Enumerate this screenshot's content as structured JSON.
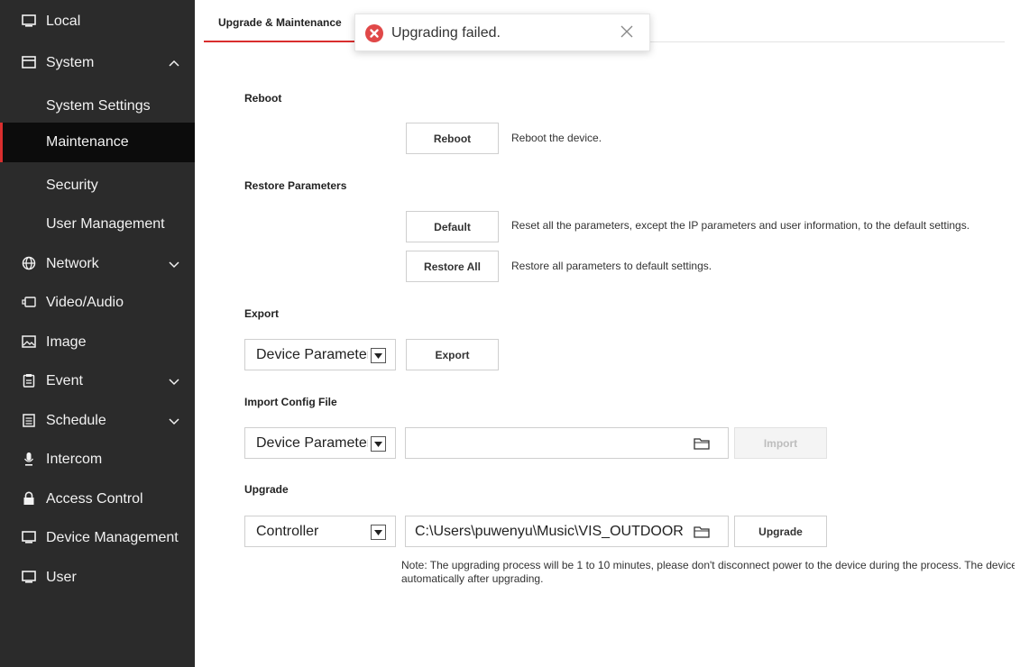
{
  "sidebar": {
    "local": "Local",
    "system": "System",
    "system_settings": "System Settings",
    "maintenance": "Maintenance",
    "security": "Security",
    "user_management": "User Management",
    "network": "Network",
    "video_audio": "Video/Audio",
    "image": "Image",
    "event": "Event",
    "schedule": "Schedule",
    "intercom": "Intercom",
    "access_control": "Access Control",
    "device_management": "Device Management",
    "user": "User"
  },
  "main": {
    "tab": "Upgrade & Maintenance",
    "reboot": {
      "title": "Reboot",
      "button": "Reboot",
      "description": "Reboot the device."
    },
    "restore": {
      "title": "Restore Parameters",
      "default_button": "Default",
      "default_description": "Reset all the parameters, except the IP parameters and user information, to the default settings.",
      "restore_all_button": "Restore All",
      "restore_all_description": "Restore all parameters to default settings."
    },
    "export": {
      "title": "Export",
      "select_value": "Device Parameters",
      "button": "Export"
    },
    "import": {
      "title": "Import Config File",
      "select_value": "Device Parameters",
      "file_value": "",
      "button": "Import"
    },
    "upgrade": {
      "title": "Upgrade",
      "select_value": "Controller",
      "file_value": "C:\\Users\\puwenyu\\Music\\VIS_OUTDOOR",
      "button": "Upgrade"
    },
    "note_line1": "Note: The upgrading process will be 1 to 10 minutes, please don't disconnect power to the device during the process. The device reboots",
    "note_line2": "automatically after upgrading."
  },
  "toast": {
    "message": "Upgrading failed."
  },
  "colors": {
    "sidebar_bg": "#2b2b2b",
    "active_bg": "#0c0c0c",
    "accent_red": "#d92e2e"
  }
}
